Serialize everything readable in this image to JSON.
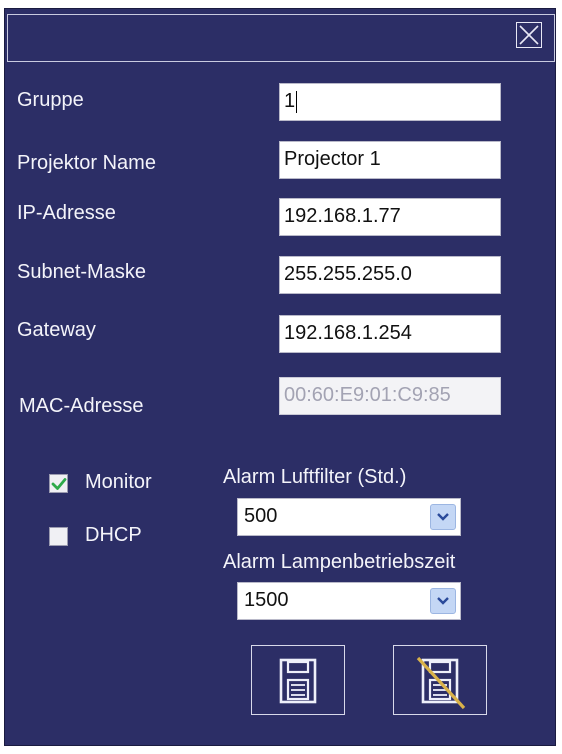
{
  "dialog": {
    "close_icon": "close-x-box-icon"
  },
  "fields": {
    "gruppe": {
      "label": "Gruppe",
      "value": "1"
    },
    "projektor_name": {
      "label": "Projektor Name",
      "value": "Projector 1"
    },
    "ip_adresse": {
      "label": "IP-Adresse",
      "value": "192.168.1.77"
    },
    "subnet_maske": {
      "label": "Subnet-Maske",
      "value": "255.255.255.0"
    },
    "gateway": {
      "label": "Gateway",
      "value": "192.168.1.254"
    },
    "mac_adresse": {
      "label": "MAC-Adresse",
      "value": "00:60:E9:01:C9:85"
    }
  },
  "options": {
    "monitor": {
      "label": "Monitor",
      "checked": true
    },
    "dhcp": {
      "label": "DHCP",
      "checked": false
    }
  },
  "alarms": {
    "luftfilter": {
      "label": "Alarm Luftfilter (Std.)",
      "selected": "500"
    },
    "lampe": {
      "label": "Alarm Lampenbetriebszeit",
      "selected": "1500"
    }
  },
  "buttons": {
    "save_icon": "floppy-disk-icon",
    "discard_icon": "floppy-disk-crossed-icon"
  },
  "colors": {
    "panel_bg": "#2c2e66",
    "text": "#f4f4fa",
    "checkmark": "#2eaa4a",
    "strike": "#d9b24a"
  }
}
